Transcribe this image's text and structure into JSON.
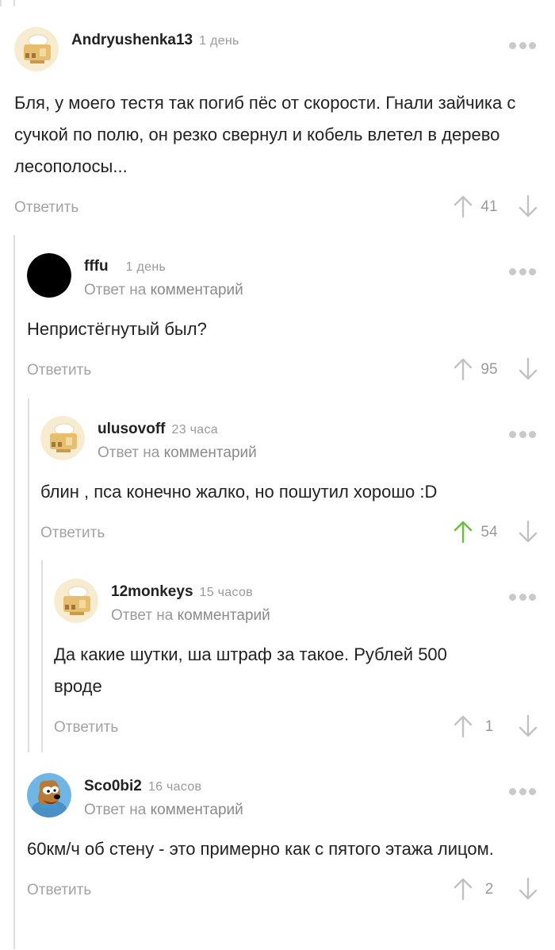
{
  "comments": [
    {
      "username": "Andryushenka13",
      "time": "1 день",
      "reply_prefix": "",
      "reply_link": "",
      "text": "Бля, у моего тестя так погиб пёс от скорости. Гнали зайчика с сучкой по полю, он резко свернул и кобель влетел в дерево лесополосы...",
      "reply_label": "Ответить",
      "rating": "41",
      "avatar_icon": "default-avatar-icon",
      "upvoted": false
    },
    {
      "username": "fffu",
      "time": "1 день",
      "reply_prefix": "Ответ на",
      "reply_link": "комментарий",
      "text": "Непристёгнутый был?",
      "reply_label": "Ответить",
      "rating": "95",
      "avatar_icon": "black-circle-avatar-icon",
      "upvoted": false
    },
    {
      "username": "ulusovoff",
      "time": "23 часа",
      "reply_prefix": "Ответ на",
      "reply_link": "комментарий",
      "text": "блин , пса конечно жалко, но пошутил хорошо :D",
      "reply_label": "Ответить",
      "rating": "54",
      "avatar_icon": "default-avatar-icon",
      "upvoted": true
    },
    {
      "username": "12monkeys",
      "time": "15 часов",
      "reply_prefix": "Ответ на",
      "reply_link": "комментарий",
      "text": "Да какие шутки, ша штраф за такое. Рублей 500 вроде",
      "reply_label": "Ответить",
      "rating": "1",
      "avatar_icon": "default-avatar-icon",
      "upvoted": false
    },
    {
      "username": "Sco0bi2",
      "time": "16 часов",
      "reply_prefix": "Ответ на",
      "reply_link": "комментарий",
      "text": "60км/ч об стену - это примерно как с пятого этажа лицом.",
      "reply_label": "Ответить",
      "rating": "2",
      "avatar_icon": "scooby-doo-avatar-icon",
      "upvoted": false
    }
  ],
  "colors": {
    "upvote_active": "#6bbf3c",
    "vote_inactive": "#c2c2c2",
    "thread_line": "#dedede"
  }
}
